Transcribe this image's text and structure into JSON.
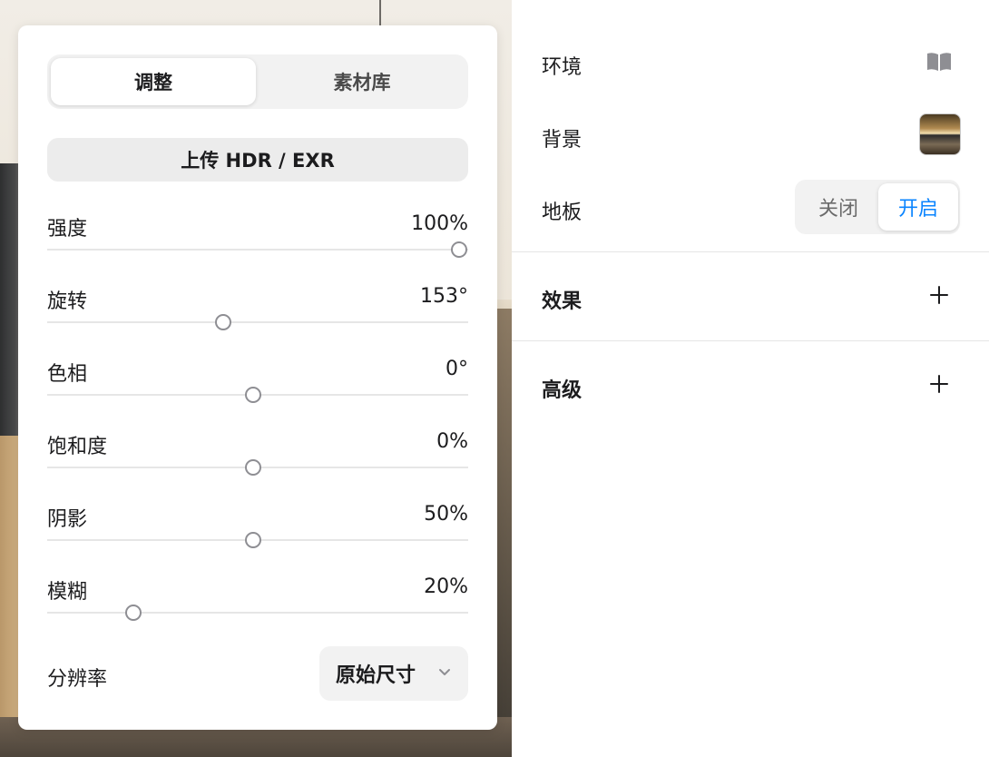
{
  "panel": {
    "tabs": [
      {
        "label": "调整",
        "active": true
      },
      {
        "label": "素材库",
        "active": false
      }
    ],
    "upload_label": "上传 HDR / EXR",
    "sliders": [
      {
        "label": "强度",
        "value": "100%",
        "level": 1.0
      },
      {
        "label": "旋转",
        "value": "153°",
        "level": 0.428
      },
      {
        "label": "色相",
        "value": "0°",
        "level": 0.5
      },
      {
        "label": "饱和度",
        "value": "0%",
        "level": 0.5
      },
      {
        "label": "阴影",
        "value": "50%",
        "level": 0.5
      },
      {
        "label": "模糊",
        "value": "20%",
        "level": 0.21
      }
    ],
    "resolution": {
      "label": "分辨率",
      "selected": "原始尺寸"
    }
  },
  "settings": {
    "environment": {
      "label": "环境",
      "icon": "book-icon"
    },
    "background": {
      "label": "背景"
    },
    "floor": {
      "label": "地板",
      "options": [
        {
          "label": "关闭",
          "selected": false
        },
        {
          "label": "开启",
          "selected": true
        }
      ]
    },
    "effects": {
      "title": "效果"
    },
    "advanced": {
      "title": "高级"
    }
  },
  "colors": {
    "accent": "#0a84ff",
    "text": "#1c1c1e",
    "control_bg": "#f2f2f2"
  }
}
